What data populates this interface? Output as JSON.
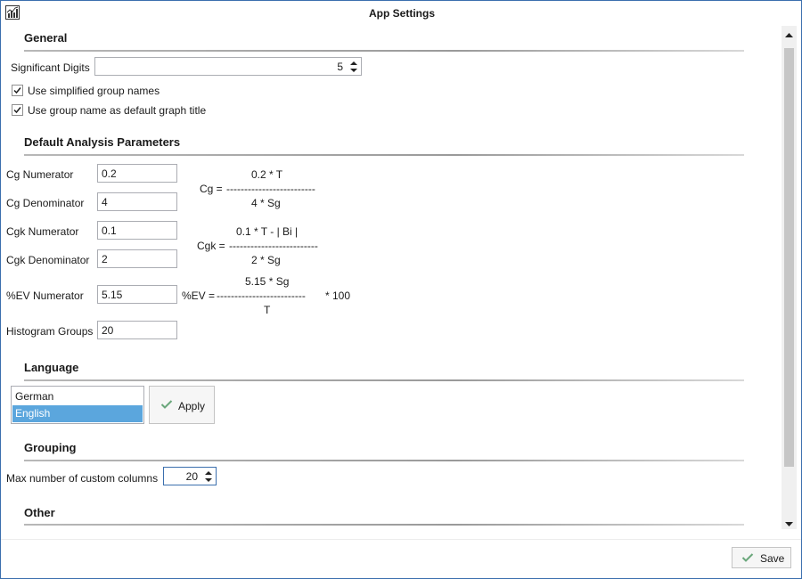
{
  "window": {
    "title": "App Settings"
  },
  "general": {
    "heading": "General",
    "significant_digits_label": "Significant Digits",
    "significant_digits_value": "5",
    "simplified_names_label": "Use simplified group names",
    "simplified_names_checked": true,
    "group_title_label": "Use group name as default graph title",
    "group_title_checked": true
  },
  "analysis": {
    "heading": "Default Analysis Parameters",
    "cg_num_label": "Cg Numerator",
    "cg_num_value": "0.2",
    "cg_den_label": "Cg Denominator",
    "cg_den_value": "4",
    "cgk_num_label": "Cgk Numerator",
    "cgk_num_value": "0.1",
    "cgk_den_label": "Cgk Denominator",
    "cgk_den_value": "2",
    "ev_num_label": "%EV Numerator",
    "ev_num_value": "5.15",
    "hist_label": "Histogram Groups",
    "hist_value": "20",
    "cg_formula": {
      "numerator": "0.2 * T",
      "left": "Cg =",
      "line": "-------------------------",
      "denominator": "4 * Sg"
    },
    "cgk_formula": {
      "numerator": "0.1 * T - | Bi |",
      "left": "Cgk =",
      "line": "-------------------------",
      "denominator": "2 * Sg"
    },
    "ev_formula": {
      "numerator": "5.15 * Sg",
      "left": "%EV =",
      "line": "-------------------------",
      "suffix": "* 100",
      "denominator": "T"
    }
  },
  "language": {
    "heading": "Language",
    "options": [
      "German",
      "English"
    ],
    "selected": "English",
    "apply_label": "Apply"
  },
  "grouping": {
    "heading": "Grouping",
    "max_columns_label": "Max number of custom columns",
    "max_columns_value": "20"
  },
  "other": {
    "heading": "Other"
  },
  "footer": {
    "save_label": "Save"
  },
  "colors": {
    "accent": "#3b6fae",
    "selection": "#5ba6dd",
    "check": "#6aa77b"
  }
}
